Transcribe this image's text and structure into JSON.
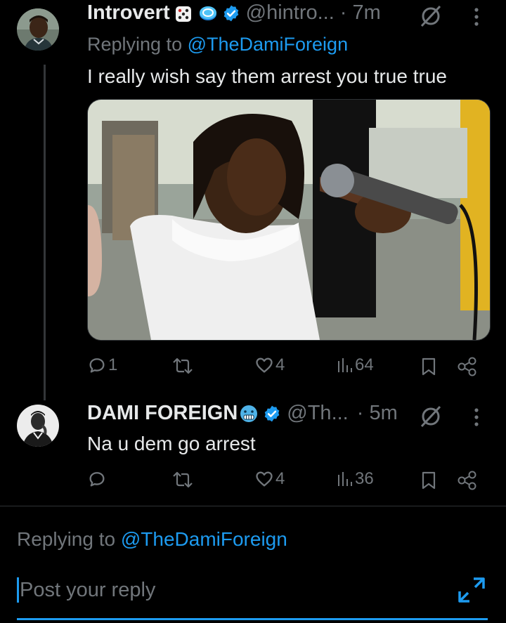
{
  "tweets": [
    {
      "name": "Introvert",
      "handle": "@hintro...",
      "time": "· 7m",
      "replying_prefix": "Replying to ",
      "replying_handle": "@TheDamiForeign",
      "text": "I really wish say them arrest you true true",
      "has_media": true,
      "actions": {
        "replies": "1",
        "retweets": "",
        "likes": "4",
        "views": "64"
      }
    },
    {
      "name": "DAMI FOREIGN",
      "handle": "@Th...",
      "time": "· 5m",
      "text": "Na u dem go arrest",
      "actions": {
        "replies": "",
        "retweets": "",
        "likes": "4",
        "views": "36"
      }
    }
  ],
  "composer": {
    "replying_prefix": "Replying to ",
    "replying_handle": "@TheDamiForeign",
    "placeholder": "Post your reply"
  },
  "colors": {
    "background": "#000000",
    "text": "#e7e9ea",
    "muted": "#71767b",
    "accent": "#1d9bf0"
  },
  "icons": [
    "dice-emoji-icon",
    "spinning-coin-emoji-icon",
    "verified-badge-icon",
    "cold-face-emoji-icon",
    "mute-icon",
    "more-icon",
    "reply-icon",
    "retweet-icon",
    "like-icon",
    "views-icon",
    "bookmark-icon",
    "share-icon",
    "expand-icon"
  ]
}
